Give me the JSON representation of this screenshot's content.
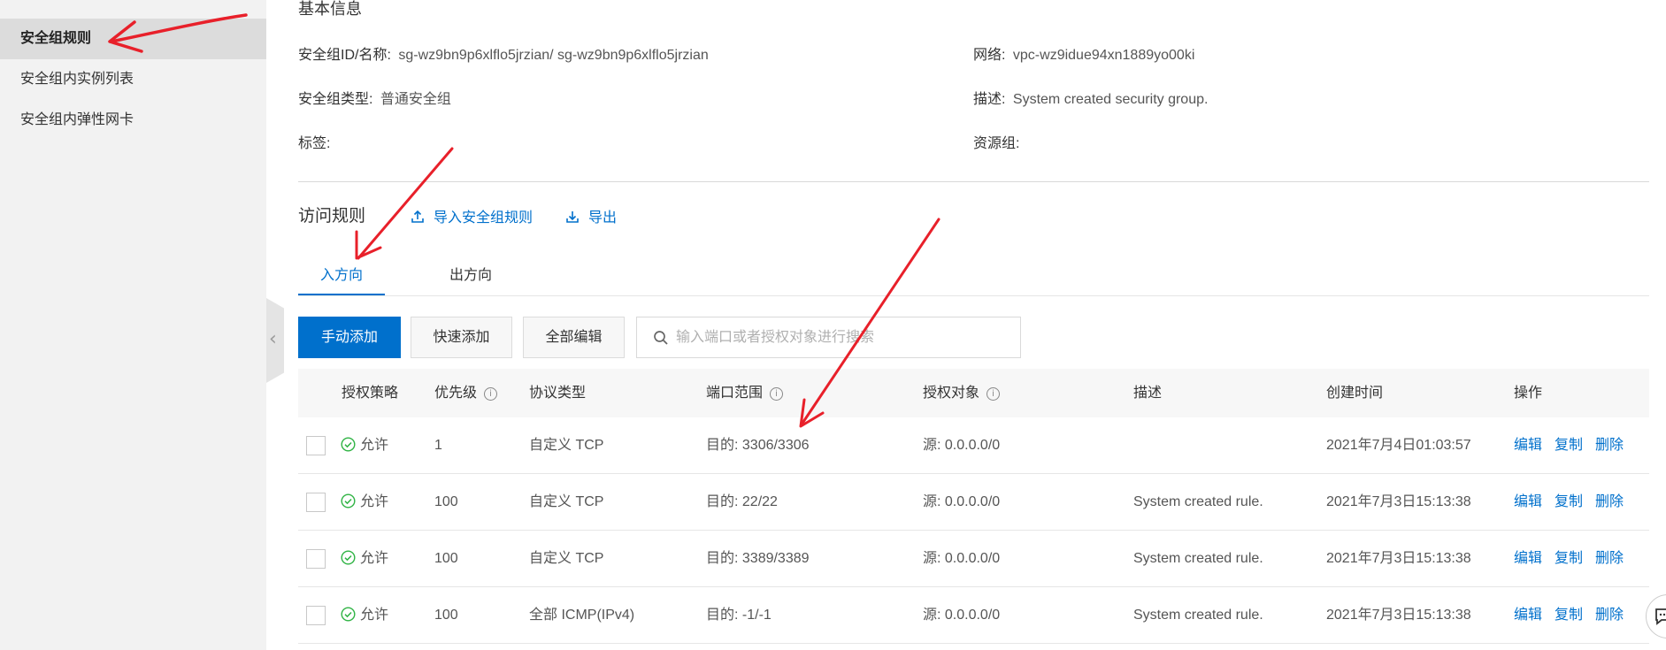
{
  "sidebar": {
    "items": [
      {
        "label": "安全组规则",
        "active": true
      },
      {
        "label": "安全组内实例列表",
        "active": false
      },
      {
        "label": "安全组内弹性网卡",
        "active": false
      }
    ]
  },
  "basic_info": {
    "title": "基本信息",
    "id_label": "安全组ID/名称:",
    "id_value": "sg-wz9bn9p6xlflo5jrzian/ sg-wz9bn9p6xlflo5jrzian",
    "network_label": "网络:",
    "network_value": "vpc-wz9idue94xn1889yo00ki",
    "type_label": "安全组类型:",
    "type_value": "普通安全组",
    "desc_label": "描述:",
    "desc_value": "System created security group.",
    "tag_label": "标签:",
    "resource_group_label": "资源组:"
  },
  "access_rules": {
    "title": "访问规则",
    "import_label": "导入安全组规则",
    "export_label": "导出"
  },
  "tabs": [
    {
      "label": "入方向",
      "active": true
    },
    {
      "label": "出方向",
      "active": false
    }
  ],
  "toolbar": {
    "manual_add": "手动添加",
    "quick_add": "快速添加",
    "edit_all": "全部编辑",
    "search_placeholder": "输入端口或者授权对象进行搜索"
  },
  "table": {
    "headers": {
      "policy": "授权策略",
      "priority": "优先级",
      "protocol": "协议类型",
      "port": "端口范围",
      "target": "授权对象",
      "description": "描述",
      "created": "创建时间",
      "actions": "操作"
    },
    "rows": [
      {
        "policy": "允许",
        "priority": "1",
        "protocol": "自定义 TCP",
        "port": "目的: 3306/3306",
        "target": "源: 0.0.0.0/0",
        "description": "",
        "created": "2021年7月4日01:03:57"
      },
      {
        "policy": "允许",
        "priority": "100",
        "protocol": "自定义 TCP",
        "port": "目的: 22/22",
        "target": "源: 0.0.0.0/0",
        "description": "System created rule.",
        "created": "2021年7月3日15:13:38"
      },
      {
        "policy": "允许",
        "priority": "100",
        "protocol": "自定义 TCP",
        "port": "目的: 3389/3389",
        "target": "源: 0.0.0.0/0",
        "description": "System created rule.",
        "created": "2021年7月3日15:13:38"
      },
      {
        "policy": "允许",
        "priority": "100",
        "protocol": "全部 ICMP(IPv4)",
        "port": "目的: -1/-1",
        "target": "源: 0.0.0.0/0",
        "description": "System created rule.",
        "created": "2021年7月3日15:13:38"
      }
    ],
    "action_labels": {
      "edit": "编辑",
      "copy": "复制",
      "delete": "删除"
    }
  },
  "colors": {
    "accent": "#0070cc",
    "allow_green": "#2fb344",
    "annotation_red": "#e8202a"
  },
  "icons": [
    "upload-icon",
    "download-icon",
    "search-icon",
    "check-circle-icon",
    "chevron-left-icon",
    "chat-icon"
  ]
}
